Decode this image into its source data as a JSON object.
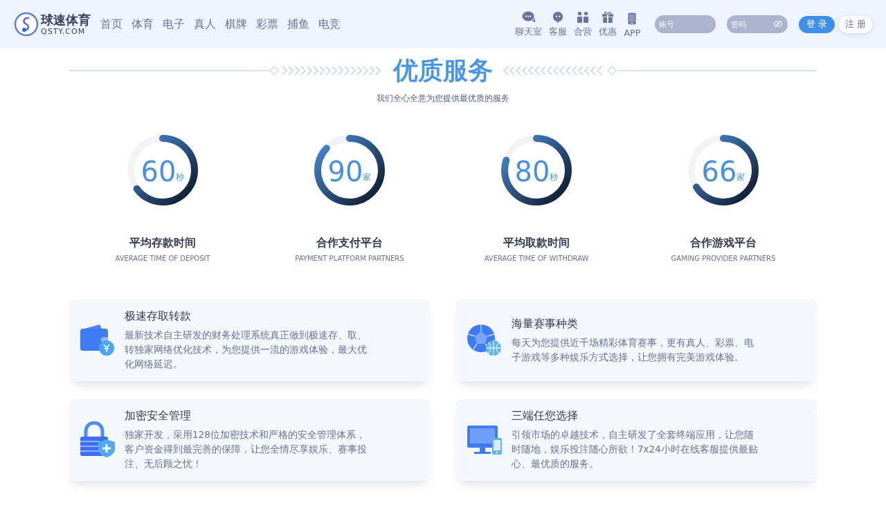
{
  "header": {
    "logo": {
      "name": "球速体育",
      "domain": "QSTY.COM"
    },
    "nav": [
      {
        "label": "首页"
      },
      {
        "label": "体育"
      },
      {
        "label": "电子"
      },
      {
        "label": "真人"
      },
      {
        "label": "棋牌"
      },
      {
        "label": "彩票"
      },
      {
        "label": "捕鱼"
      },
      {
        "label": "电竞"
      }
    ],
    "quick_links": [
      {
        "kind": "chat",
        "label": "聊天室"
      },
      {
        "kind": "service",
        "label": "客服"
      },
      {
        "kind": "partner",
        "label": "合营"
      },
      {
        "kind": "gift",
        "label": "优惠"
      },
      {
        "kind": "phone",
        "label": "APP"
      }
    ],
    "account_field": {
      "placeholder": "账号"
    },
    "password_field": {
      "placeholder": "密码"
    },
    "login_button": "登 录",
    "register_button": "注 册"
  },
  "section": {
    "title": "优质服务",
    "subtitle": "我们全心全意为您提供最优质的服务"
  },
  "stats": [
    {
      "value": "60",
      "unit": "秒",
      "level": 0.65,
      "title": "平均存款时间",
      "subtitle": "AVERAGE TIME OF DEPOSIT"
    },
    {
      "value": "90",
      "unit": "家",
      "level": 0.87,
      "title": "合作支付平台",
      "subtitle": "PAYMENT PLATFORM PARTNERS"
    },
    {
      "value": "80",
      "unit": "秒",
      "level": 0.8,
      "title": "平均取款时间",
      "subtitle": "AVERAGE TIME OF WITHDRAW"
    },
    {
      "value": "66",
      "unit": "家",
      "level": 0.66,
      "title": "合作游戏平台",
      "subtitle": "GAMING PROVIDER PARTNERS"
    }
  ],
  "features": [
    {
      "kind": "wallet",
      "title": "极速存取转款",
      "text": "最新技术自主研发的财务处理系统真正做到极速存、取、转独家网络优化技术，为您提供一流的游戏体验，最大优化网络延迟。"
    },
    {
      "kind": "balls",
      "title": "海量赛事种类",
      "text": "每天为您提供近千场精彩体育赛事，更有真人、彩票、电子游戏等多种娱乐方式选择，让您拥有完美游戏体验。"
    },
    {
      "kind": "lock",
      "title": "加密安全管理",
      "text": "独家开发，采用128位加密技术和严格的安全管理体系，客户资金得到最完善的保障，让您全情尽享娱乐、赛事投注、无后顾之忧！"
    },
    {
      "kind": "devices",
      "title": "三端任您选择",
      "text": "引领市场的卓越技术，自主研发了全套终端应用，让您随时随地，娱乐投注随心所欲！7x24小时在线客服提供最贴心、最优质的服务。"
    }
  ]
}
